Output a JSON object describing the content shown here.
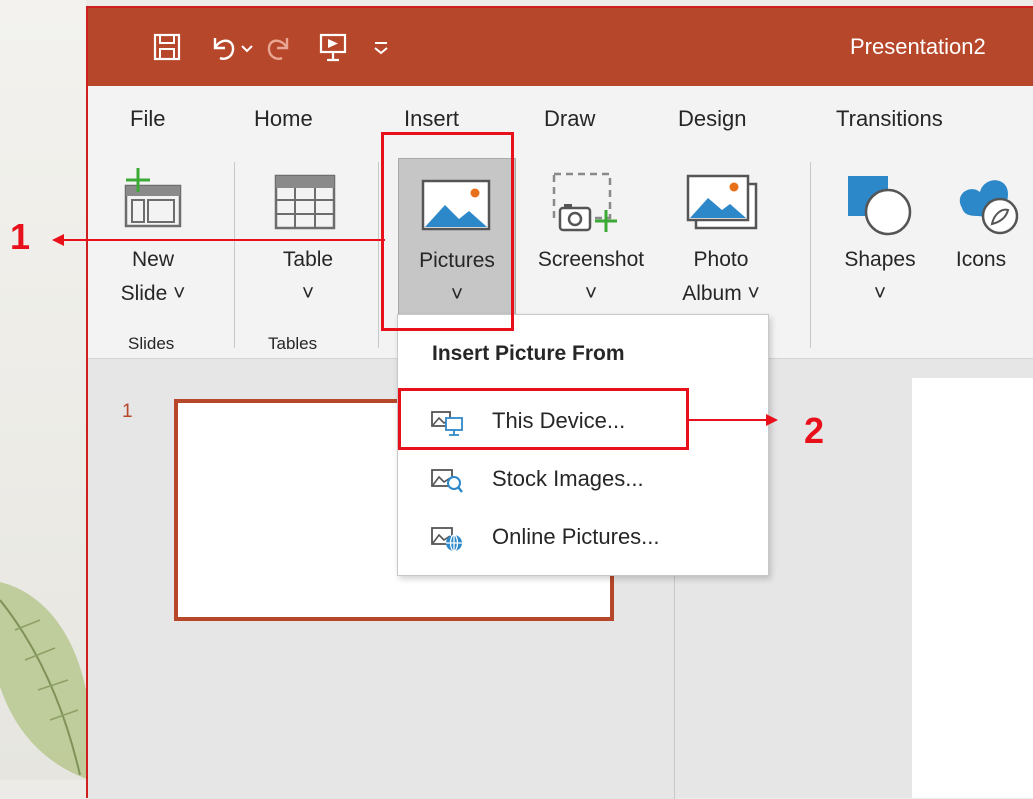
{
  "window": {
    "title": "Presentation2"
  },
  "ribbon_tabs": [
    "File",
    "Home",
    "Insert",
    "Draw",
    "Design",
    "Transitions"
  ],
  "active_tab": "Insert",
  "ribbon": {
    "new_slide": {
      "line1": "New",
      "line2": "Slide ˅"
    },
    "table": {
      "line1": "Table",
      "chevron": "˅"
    },
    "pictures": {
      "line1": "Pictures",
      "chevron": "˅"
    },
    "screenshot": {
      "line1": "Screenshot",
      "chevron": "˅"
    },
    "photo_album": {
      "line1": "Photo",
      "line2": "Album ˅"
    },
    "shapes": {
      "line1": "Shapes",
      "chevron": "˅"
    },
    "icons": {
      "line1": "Icons"
    },
    "groups": {
      "slides": "Slides",
      "tables": "Tables"
    }
  },
  "slide_pane": {
    "slide_number": "1"
  },
  "dropdown": {
    "header": "Insert Picture From",
    "items": [
      {
        "label": "This Device...",
        "icon": "picture-device-icon"
      },
      {
        "label": "Stock Images...",
        "icon": "picture-search-icon"
      },
      {
        "label": "Online Pictures...",
        "icon": "picture-globe-icon"
      }
    ]
  },
  "callouts": {
    "step1": "1",
    "step2": "2"
  },
  "colors": {
    "accent": "#b7472a",
    "highlight": "#e8111b"
  }
}
